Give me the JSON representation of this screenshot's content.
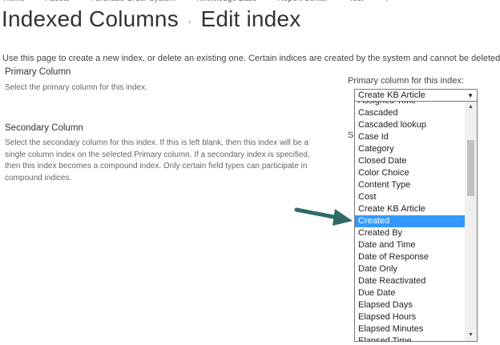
{
  "topnav": [
    "Home",
    "Assets",
    "Purchase Order System",
    "Knowledge Base",
    "Report Center",
    "Test",
    "Test"
  ],
  "title": {
    "parent": "Indexed Columns",
    "separator": "›",
    "current": "Edit index"
  },
  "intro": "Use this page to create a new index, or delete an existing one. Certain indices are created by the system and cannot be deleted.",
  "primary": {
    "title": "Primary Column",
    "desc": "Select the primary column for this index.",
    "label": "Primary column for this index:",
    "selected_value": "Create KB Article"
  },
  "secondary": {
    "title": "Secondary Column",
    "desc": "Select the secondary column for this index. If this is left blank, then this index will be a single column index on the selected Primary column. If a secondary index is specified, then this index becomes a compound index. Only certain field types can participate in compound indices.",
    "label_stub": "Se"
  },
  "options": [
    "Assigned Time",
    "Cascaded",
    "Cascaded lookup",
    "Case Id",
    "Category",
    "Closed Date",
    "Color Choice",
    "Content Type",
    "Cost",
    "Create KB Article",
    "Created",
    "Created By",
    "Date and Time",
    "Date of Response",
    "Date Only",
    "Date Reactivated",
    "Due Date",
    "Elapsed Days",
    "Elapsed Hours",
    "Elapsed Minutes",
    "Elapsed Time"
  ],
  "highlighted_option": "Created",
  "colors": {
    "highlight": "#3399ff",
    "arrow": "#2e6b66"
  },
  "icons": {
    "dropdown": "chevron-down-icon",
    "scroll_up": "scroll-up-icon",
    "scroll_down": "scroll-down-icon",
    "annotation": "annotation-arrow-icon"
  }
}
